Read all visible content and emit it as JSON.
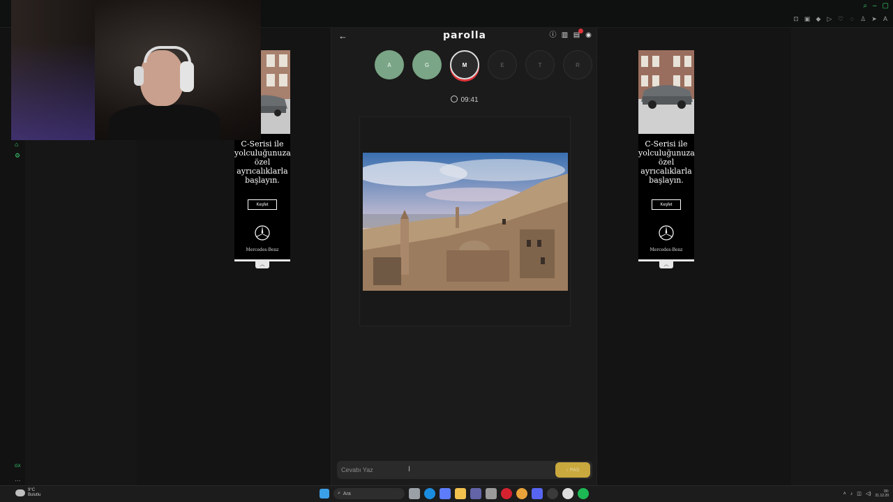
{
  "app": {
    "title": "parolla"
  },
  "letters": [
    {
      "char": "A",
      "state": "done"
    },
    {
      "char": "G",
      "state": "done"
    },
    {
      "char": "M",
      "state": "active"
    },
    {
      "char": "E",
      "state": "pending"
    },
    {
      "char": "T",
      "state": "pending"
    },
    {
      "char": "R",
      "state": "pending"
    }
  ],
  "timer": {
    "value": "09:41"
  },
  "answer": {
    "placeholder": "Cevabı Yaz",
    "value": "",
    "pass_label": "PAS"
  },
  "ad": {
    "text_line1": "C-Serisi ile",
    "text_line2": "yolculuğunuza",
    "text_line3": "özel",
    "text_line4": "ayrıcalıklarla",
    "text_line5": "başlayın.",
    "button": "Keşfet",
    "brand": "Mercedes-Benz"
  },
  "taskbar": {
    "weather_temp": "9°C",
    "weather_desc": "Bulutlu",
    "search": "Ara",
    "time": "00:",
    "date": "21.12.20"
  },
  "colors": {
    "letter_done": "#7aa586",
    "active_ring": "#e0343a",
    "pass_button": "#c9a83e",
    "browser_accent": "#3bd16f"
  },
  "icons": [
    "back-arrow-icon",
    "info-icon",
    "stats-icon",
    "notifications-icon",
    "user-icon",
    "clock-icon",
    "mercedes-star-icon",
    "windows-start-icon",
    "search-icon"
  ]
}
